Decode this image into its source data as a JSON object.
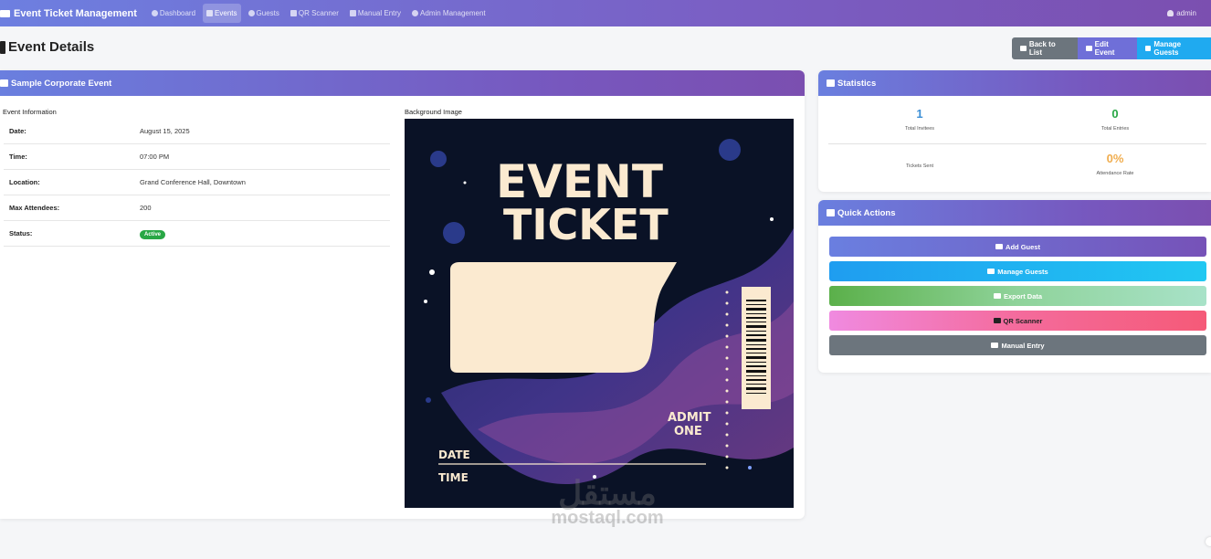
{
  "navbar": {
    "brand": "Event Ticket Management",
    "items": [
      {
        "label": "Dashboard",
        "icon": "dashboard-icon",
        "active": false
      },
      {
        "label": "Events",
        "icon": "calendar-icon",
        "active": true
      },
      {
        "label": "Guests",
        "icon": "users-icon",
        "active": false
      },
      {
        "label": "QR Scanner",
        "icon": "camera-icon",
        "active": false
      },
      {
        "label": "Manual Entry",
        "icon": "keyboard-icon",
        "active": false
      },
      {
        "label": "Admin Management",
        "icon": "user-cog-icon",
        "active": false
      }
    ],
    "user": "admin"
  },
  "page": {
    "title": "Event Details",
    "buttons": {
      "back": "Back to List",
      "edit": "Edit Event",
      "manage_guests": "Manage Guests"
    }
  },
  "event_card": {
    "header": "Sample Corporate Event",
    "info_label": "Event Information",
    "image_label": "Background Image",
    "rows": [
      {
        "key": "Date:",
        "value": "August 15, 2025"
      },
      {
        "key": "Time:",
        "value": "07:00 PM"
      },
      {
        "key": "Location:",
        "value": "Grand Conference Hall, Downtown"
      },
      {
        "key": "Max Attendees:",
        "value": "200"
      },
      {
        "key": "Status:",
        "value": "Active"
      }
    ],
    "ticket_image": {
      "line1": "EVENT",
      "line2": "TICKET",
      "admit": "ADMIT",
      "admit2": "ONE",
      "date": "DATE",
      "time": "TIME"
    }
  },
  "statistics": {
    "header": "Statistics",
    "total_invitees": {
      "value": "1",
      "label": "Total Invitees"
    },
    "total_entries": {
      "value": "0",
      "label": "Total Entries"
    },
    "tickets_sent": {
      "value": "",
      "label": "Tickets Sent"
    },
    "attendance_rate": {
      "value": "0%",
      "label": "Attendance Rate"
    }
  },
  "quick_actions": {
    "header": "Quick Actions",
    "buttons": [
      "Add Guest",
      "Manage Guests",
      "Export Data",
      "QR Scanner",
      "Manual Entry"
    ]
  },
  "watermark": {
    "arabic": "مستقل",
    "latin": "mostaql.com"
  },
  "colors": {
    "accent": "#7b5fc4",
    "success": "#28a745",
    "info": "#1faaf0",
    "warning": "#f0ad4e",
    "secondary": "#6c757d"
  }
}
